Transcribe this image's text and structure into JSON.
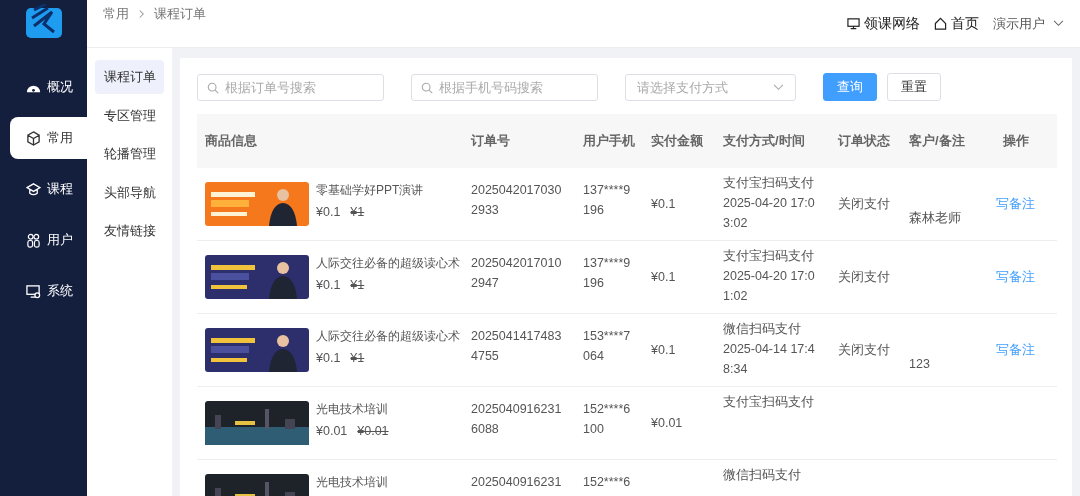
{
  "sidebar": {
    "items": [
      {
        "label": "概况",
        "selected": false
      },
      {
        "label": "常用",
        "selected": true
      },
      {
        "label": "课程",
        "selected": false
      },
      {
        "label": "用户",
        "selected": false
      },
      {
        "label": "系统",
        "selected": false
      }
    ]
  },
  "breadcrumb": [
    "常用",
    "课程订单"
  ],
  "header": {
    "links": [
      {
        "label": "领课网络"
      },
      {
        "label": "首页"
      }
    ],
    "user": "演示用户"
  },
  "submenu": [
    {
      "label": "课程订单",
      "selected": true
    },
    {
      "label": "专区管理",
      "selected": false
    },
    {
      "label": "轮播管理",
      "selected": false
    },
    {
      "label": "头部导航",
      "selected": false
    },
    {
      "label": "友情链接",
      "selected": false
    }
  ],
  "filters": {
    "order_search": {
      "placeholder": "根据订单号搜索"
    },
    "phone_search": {
      "placeholder": "根据手机号码搜索"
    },
    "pay_select": {
      "placeholder": "请选择支付方式"
    },
    "buttons": [
      {
        "label": "查询"
      },
      {
        "label": "重置"
      }
    ]
  },
  "table": {
    "columns": [
      "商品信息",
      "订单号",
      "用户手机",
      "实付金额",
      "支付方式/时间",
      "订单状态",
      "客户/备注",
      "操作"
    ],
    "rows": [
      {
        "title": "零基础学好PPT演讲",
        "price": "¥0.1",
        "original_price": "¥1",
        "order_no": "20250420170302933",
        "phone": "137****9196",
        "amount": "¥0.1",
        "pay_method": "支付宝扫码支付",
        "pay_time": "2025-04-20 17:03:02",
        "status": "关闭支付",
        "note": "森林老师",
        "action": "写备注"
      },
      {
        "title": "人际交往必备的超级读心术",
        "price": "¥0.1",
        "original_price": "¥1",
        "order_no": "20250420170102947",
        "phone": "137****9196",
        "amount": "¥0.1",
        "pay_method": "支付宝扫码支付",
        "pay_time": "2025-04-20 17:01:02",
        "status": "关闭支付",
        "action": "写备注"
      },
      {
        "title": "人际交往必备的超级读心术",
        "price": "¥0.1",
        "original_price": "¥1",
        "order_no": "20250414174834755",
        "phone": "153****7064",
        "amount": "¥0.1",
        "pay_method": "微信扫码支付",
        "pay_time": "2025-04-14 17:48:34",
        "status": "关闭支付",
        "note": "123",
        "action": "写备注"
      },
      {
        "title": "光电技术培训",
        "price": "¥0.01",
        "original_price": "¥0.01",
        "order_no": "20250409162316088",
        "phone": "152****6100",
        "amount": "¥0.01",
        "pay_method": "支付宝扫码支付"
      },
      {
        "title": "光电技术培训",
        "order_no": "2025040916231",
        "phone": "152****6",
        "pay_method": "微信扫码支付"
      }
    ]
  }
}
